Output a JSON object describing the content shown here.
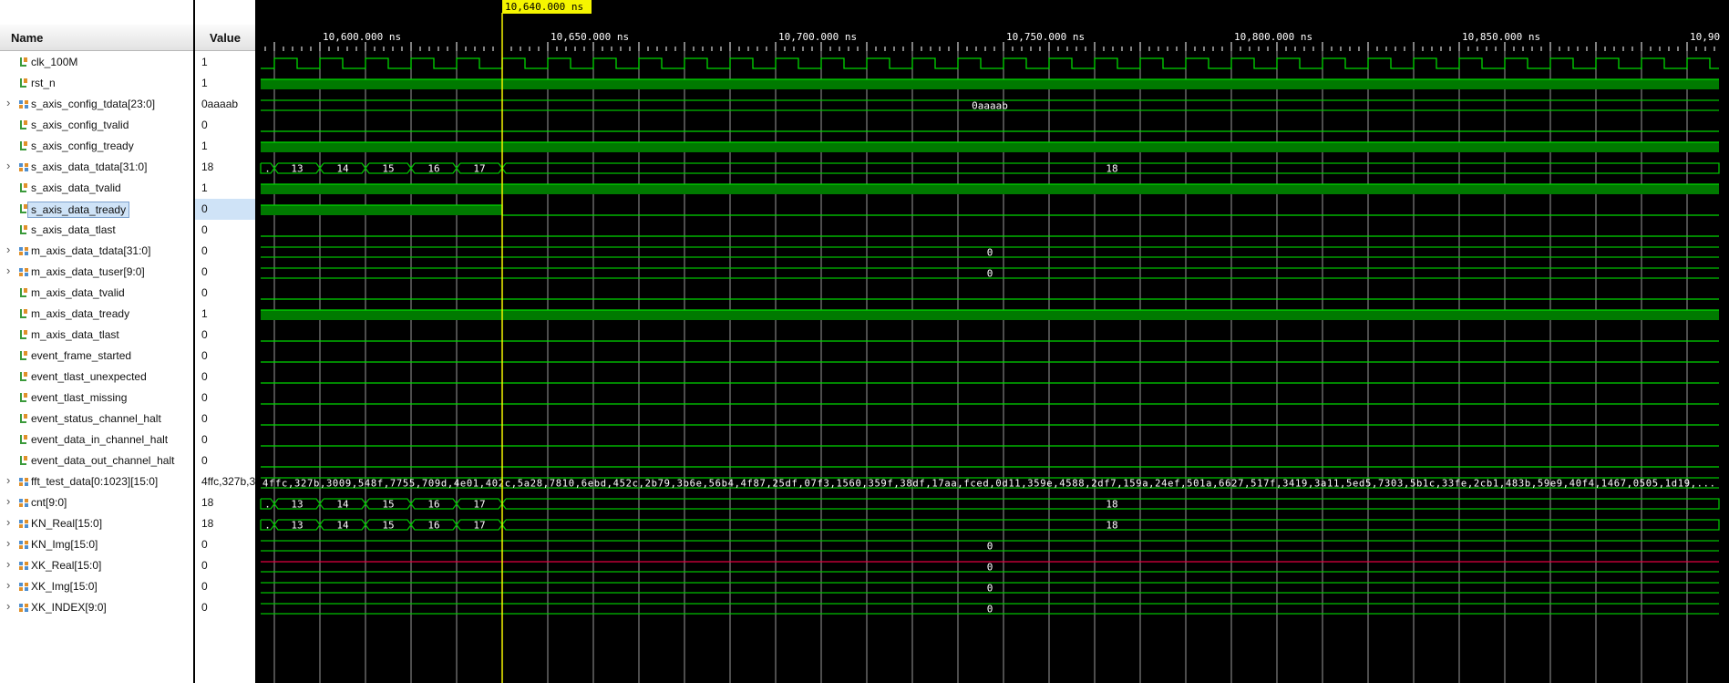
{
  "columns": {
    "name": "Name",
    "value": "Value"
  },
  "cursor": {
    "label": "10,640.000 ns",
    "time": 10640
  },
  "timeline": {
    "start": 10587,
    "end": 10907,
    "ticks": [
      {
        "t": 10600,
        "label": "10,600.000 ns"
      },
      {
        "t": 10650,
        "label": "10,650.000 ns"
      },
      {
        "t": 10700,
        "label": "10,700.000 ns"
      },
      {
        "t": 10750,
        "label": "10,750.000 ns"
      },
      {
        "t": 10800,
        "label": "10,800.000 ns"
      },
      {
        "t": 10850,
        "label": "10,850.000 ns"
      },
      {
        "t": 10900,
        "label": "10,90"
      }
    ]
  },
  "colors": {
    "wave": "#00d800",
    "fill": "#007a00",
    "bus": "#00c000",
    "cursor": "#f5f500",
    "xz": "#e00040",
    "grid": "#9a9a9a"
  },
  "signals": [
    {
      "name": "clk_100M",
      "value": "1",
      "type": "clock",
      "icon": "wire-icon"
    },
    {
      "name": "rst_n",
      "value": "1",
      "type": "high",
      "icon": "wire-icon"
    },
    {
      "name": "s_axis_config_tdata[23:0]",
      "value": "0aaaab",
      "type": "bus",
      "icon": "bus-icon",
      "center": "0aaaab"
    },
    {
      "name": "s_axis_config_tvalid",
      "value": "0",
      "type": "low",
      "icon": "wire-icon"
    },
    {
      "name": "s_axis_config_tready",
      "value": "1",
      "type": "high",
      "icon": "wire-icon"
    },
    {
      "name": "s_axis_data_tdata[31:0]",
      "value": "18",
      "type": "counter",
      "icon": "bus-icon",
      "center": "18"
    },
    {
      "name": "s_axis_data_tvalid",
      "value": "1",
      "type": "high",
      "icon": "wire-icon"
    },
    {
      "name": "s_axis_data_tready",
      "value": "0",
      "type": "fall",
      "icon": "wire-icon",
      "selected": true
    },
    {
      "name": "s_axis_data_tlast",
      "value": "0",
      "type": "low",
      "icon": "wire-icon"
    },
    {
      "name": "m_axis_data_tdata[31:0]",
      "value": "0",
      "type": "bus",
      "icon": "bus-icon",
      "center": "0"
    },
    {
      "name": "m_axis_data_tuser[9:0]",
      "value": "0",
      "type": "bus",
      "icon": "bus-icon",
      "center": "0"
    },
    {
      "name": "m_axis_data_tvalid",
      "value": "0",
      "type": "low",
      "icon": "wire-icon"
    },
    {
      "name": "m_axis_data_tready",
      "value": "1",
      "type": "high",
      "icon": "wire-icon"
    },
    {
      "name": "m_axis_data_tlast",
      "value": "0",
      "type": "low",
      "icon": "wire-icon"
    },
    {
      "name": "event_frame_started",
      "value": "0",
      "type": "low",
      "icon": "wire-icon"
    },
    {
      "name": "event_tlast_unexpected",
      "value": "0",
      "type": "low",
      "icon": "wire-icon"
    },
    {
      "name": "event_tlast_missing",
      "value": "0",
      "type": "low",
      "icon": "wire-icon"
    },
    {
      "name": "event_status_channel_halt",
      "value": "0",
      "type": "low",
      "icon": "wire-icon"
    },
    {
      "name": "event_data_in_channel_halt",
      "value": "0",
      "type": "low",
      "icon": "wire-icon"
    },
    {
      "name": "event_data_out_channel_halt",
      "value": "0",
      "type": "low",
      "icon": "wire-icon"
    },
    {
      "name": "fft_test_data[0:1023][15:0]",
      "value": "4ffc,327b,3",
      "type": "array",
      "icon": "bus-icon",
      "center": "4ffc,327b,3009,548f,7755,709d,4e01,402c,5a28,7810,6ebd,452c,2b79,3b6e,56b4,4f87,25df,07f3,1560,359f,38df,17aa,fced,0d11,359e,4588,2df7,159a,24ef,501a,6627,517f,3419,3a11,5ed5,7303,5b1c,33fe,2cb1,483b,59e9,40f4,1467,0505,1d19,..."
    },
    {
      "name": "cnt[9:0]",
      "value": "18",
      "type": "counter",
      "icon": "bus-icon",
      "center": "18"
    },
    {
      "name": "KN_Real[15:0]",
      "value": "18",
      "type": "counter",
      "icon": "bus-icon",
      "center": "18"
    },
    {
      "name": "KN_Img[15:0]",
      "value": "0",
      "type": "bus",
      "icon": "bus-icon",
      "center": "0"
    },
    {
      "name": "XK_Real[15:0]",
      "value": "0",
      "type": "busx",
      "icon": "bus-icon",
      "center": "0"
    },
    {
      "name": "XK_Img[15:0]",
      "value": "0",
      "type": "bus",
      "icon": "bus-icon",
      "center": "0"
    },
    {
      "name": "XK_INDEX[9:0]",
      "value": "0",
      "type": "bus",
      "icon": "bus-icon",
      "center": "0"
    }
  ],
  "counter_segments": [
    {
      "label": ".",
      "t0": 10587,
      "t1": 10590
    },
    {
      "label": "13",
      "t0": 10590,
      "t1": 10600
    },
    {
      "label": "14",
      "t0": 10600,
      "t1": 10610
    },
    {
      "label": "15",
      "t0": 10610,
      "t1": 10620
    },
    {
      "label": "16",
      "t0": 10620,
      "t1": 10630
    },
    {
      "label": "17",
      "t0": 10630,
      "t1": 10640
    },
    {
      "label": "18",
      "t0": 10640,
      "t1": 10907
    }
  ]
}
